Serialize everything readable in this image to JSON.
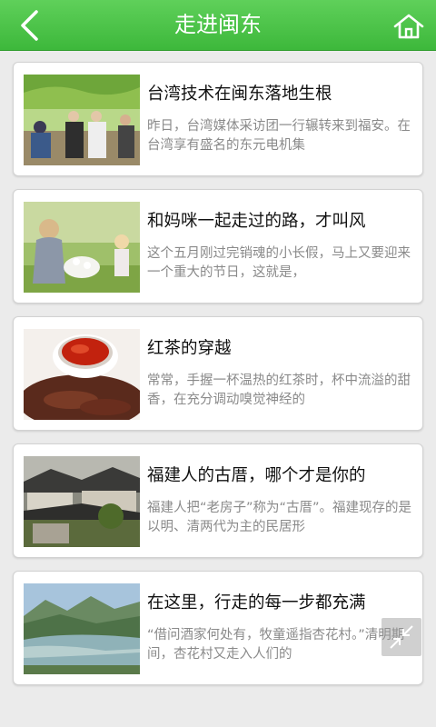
{
  "header": {
    "title": "走进闽东",
    "back_icon": "back-chevron-icon",
    "home_icon": "home-icon"
  },
  "colors": {
    "header_green": "#44bd40",
    "background": "#ebebeb",
    "title_text": "#111111",
    "summary_text": "#8a8a8a"
  },
  "articles": [
    {
      "title": "台湾技术在闽东落地生根",
      "summary": "昨日，台湾媒体采访团一行辗转来到福安。在台湾享有盛名的东元电机集",
      "image": "people-in-vineyard-photo"
    },
    {
      "title": "和妈咪一起走过的路，才叫风",
      "summary": "这个五月刚过完销魂的小长假，马上又要迎来一个重大的节日，这就是，",
      "image": "mother-and-child-with-flowers-photo"
    },
    {
      "title": "红茶的穿越",
      "summary": "常常，手握一杯温热的红茶时，杯中流溢的甜香，在充分调动嗅觉神经的",
      "image": "black-tea-cup-photo"
    },
    {
      "title": "福建人的古厝，哪个才是你的",
      "summary": "福建人把“老房子”称为“古厝”。福建现存的是以明、清两代为主的民居形",
      "image": "old-fujian-houses-photo"
    },
    {
      "title": "在这里，行走的每一步都充满",
      "summary": "“借问酒家何处有，牧童遥指杏花村。”清明期间，杏花村又走入人们的",
      "image": "river-valley-landscape-photo"
    }
  ],
  "floating_button": {
    "icon": "shrink-arrows-icon"
  }
}
